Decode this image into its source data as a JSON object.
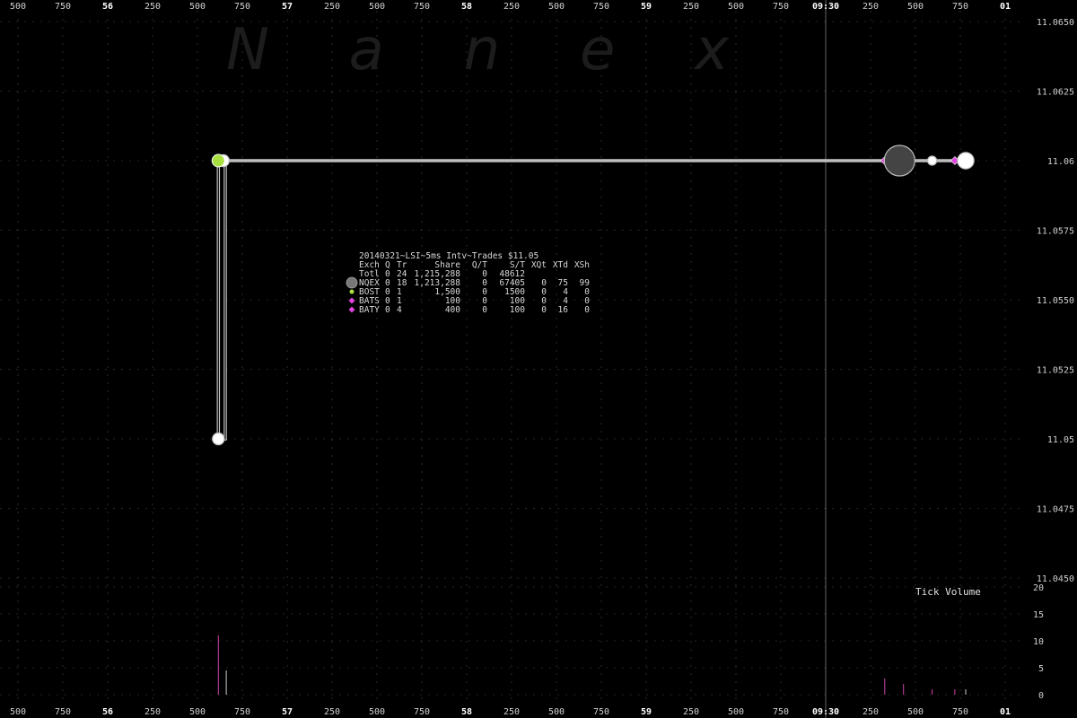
{
  "watermark": "N a n e x",
  "chart_data": {
    "type": "scatter",
    "title": "20140321~LSI~5ms Intv~Trades $11.05",
    "x_axis": {
      "tick_labels": [
        "500",
        "750",
        "56",
        "250",
        "500",
        "750",
        "57",
        "250",
        "500",
        "750",
        "58",
        "250",
        "500",
        "750",
        "59",
        "250",
        "500",
        "750",
        "09:30",
        "250",
        "500",
        "750",
        "01"
      ],
      "major_labels": [
        "56",
        "57",
        "58",
        "59",
        "09:30",
        "01"
      ]
    },
    "y_axis": {
      "tick_labels": [
        "11.0650",
        "11.0625",
        "11.06",
        "11.0575",
        "11.0550",
        "11.0525",
        "11.05",
        "11.0475",
        "11.0450"
      ],
      "ylim": [
        11.045,
        11.065
      ]
    },
    "volume_axis": {
      "label": "Tick Volume",
      "tick_labels": [
        "20",
        "15",
        "10",
        "5",
        "0"
      ],
      "ylim": [
        0,
        20
      ]
    },
    "price_path": {
      "description_free": true,
      "points": [
        {
          "x": 0.203,
          "y": 11.06
        },
        {
          "x": 0.203,
          "y": 11.05
        },
        {
          "x": 0.21,
          "y": 11.05
        },
        {
          "x": 0.21,
          "y": 11.06
        },
        {
          "x": 0.96,
          "y": 11.06
        }
      ]
    },
    "trades": [
      {
        "exchange": "NQEX",
        "x": 0.208,
        "price": 11.06,
        "size": 1
      },
      {
        "exchange": "BOST",
        "x": 0.203,
        "price": 11.06,
        "size": 1
      },
      {
        "exchange": "NQEX",
        "x": 0.203,
        "price": 11.05,
        "size": 1
      },
      {
        "exchange": "BATY",
        "x": 0.878,
        "price": 11.06,
        "size": 1
      },
      {
        "exchange": "NQEX",
        "x": 0.893,
        "price": 11.06,
        "size": 5
      },
      {
        "exchange": "NQEX",
        "x": 0.926,
        "price": 11.06,
        "size": 0.4
      },
      {
        "exchange": "BATS",
        "x": 0.949,
        "price": 11.06,
        "size": 1
      },
      {
        "exchange": "NQEX",
        "x": 0.96,
        "price": 11.06,
        "size": 2
      }
    ],
    "volume_bars": [
      {
        "x": 0.203,
        "value": 11,
        "color": "#cc44aa"
      },
      {
        "x": 0.211,
        "value": 4.5,
        "color": "#cccccc"
      },
      {
        "x": 0.878,
        "value": 3,
        "color": "#cc44aa"
      },
      {
        "x": 0.897,
        "value": 2,
        "color": "#cc44aa"
      },
      {
        "x": 0.926,
        "value": 1,
        "color": "#cc44aa"
      },
      {
        "x": 0.949,
        "value": 1,
        "color": "#cc44aa"
      },
      {
        "x": 0.96,
        "value": 1,
        "color": "#cccccc"
      }
    ],
    "legend": {
      "header": [
        "Exch",
        "Q",
        "Tr",
        "Share",
        "Q/T",
        "S/T",
        "XQt",
        "XTd",
        "XSh"
      ],
      "rows": [
        {
          "marker": "none",
          "cells": [
            "Totl",
            "0",
            "24",
            "1,215,288",
            "0",
            "48612",
            "",
            "",
            ""
          ]
        },
        {
          "marker": "gray-circle",
          "cells": [
            "NQEX",
            "0",
            "18",
            "1,213,288",
            "0",
            "67405",
            "0",
            "75",
            "99"
          ]
        },
        {
          "marker": "green-dot",
          "cells": [
            "BOST",
            "0",
            "1",
            "1,500",
            "0",
            "1500",
            "0",
            "4",
            "0"
          ]
        },
        {
          "marker": "magenta-diamond",
          "cells": [
            "BATS",
            "0",
            "1",
            "100",
            "0",
            "100",
            "0",
            "4",
            "0"
          ]
        },
        {
          "marker": "magenta-diamond",
          "cells": [
            "BATY",
            "0",
            "4",
            "400",
            "0",
            "100",
            "0",
            "16",
            "0"
          ]
        }
      ]
    },
    "colors": {
      "background": "#000000",
      "grid": "#4a4a4a",
      "price_line": "#c8c8c8",
      "nqex": "#777777",
      "bost": "#a8e040",
      "bats": "#dd44dd",
      "baty": "#dd44dd",
      "cursor_line": "#666666"
    },
    "grid": true
  }
}
